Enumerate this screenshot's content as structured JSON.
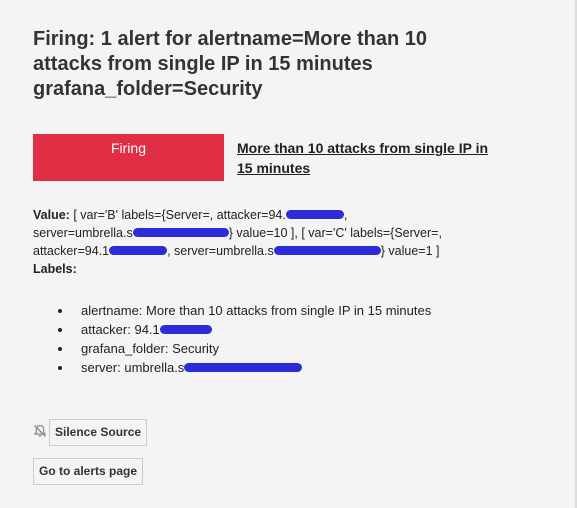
{
  "header": {
    "title_lines": [
      "Firing: 1 alert for alertname=More than 10",
      "attacks from single IP in 15 minutes",
      "grafana_folder=Security"
    ]
  },
  "status": {
    "label": "Firing",
    "color": "#e02f44"
  },
  "rule": {
    "link_lines": [
      "More than 10 attacks from single IP in",
      "15 minutes"
    ]
  },
  "value": {
    "label": "Value:",
    "line1_text": "[ var='B' labels={Server=, attacker=94.",
    "line1_end": ",",
    "line2_start": "server=umbrella.s",
    "line2_mid": "} value=10 ], [ var='C' labels={Server=,",
    "line3_start": "attacker=94.1",
    "line3_mid": ", server=umbrella.s",
    "line3_end": "} value=1 ]"
  },
  "labels": {
    "heading": "Labels:",
    "items": [
      "alertname: More than 10 attacks from single IP in 15 minutes",
      "attacker: 94.1",
      "grafana_folder: Security",
      "server: umbrella.s"
    ]
  },
  "actions": {
    "silence_label": "Silence Source",
    "alerts_label": "Go to alerts page"
  },
  "colors": {
    "redaction": "#2c2cd8",
    "background": "#f4f4f4"
  },
  "icons": {
    "silence": "bell-slash-icon"
  }
}
